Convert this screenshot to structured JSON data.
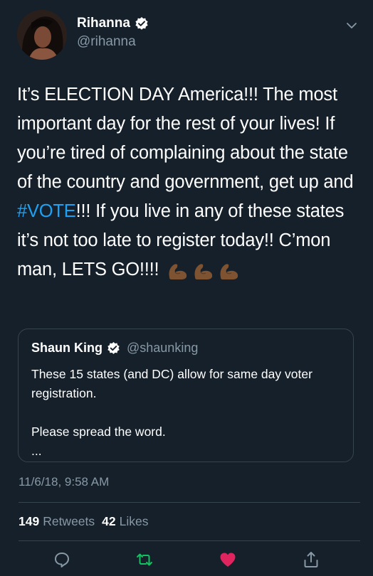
{
  "author": {
    "name": "Rihanna",
    "handle": "@rihanna"
  },
  "tweet": {
    "text_before": "It’s ELECTION DAY America!!! The most important day for the rest of your lives! If you’re tired of complaining about the state of the country and government, get up and ",
    "hashtag": "#VOTE",
    "text_after": "!!! If you live in any of these states it’s not too late to register today!! C’mon man, LETS GO!!!! ",
    "emojis": [
      "flexed-biceps-icon",
      "flexed-biceps-icon",
      "flexed-biceps-icon"
    ]
  },
  "quote": {
    "name": "Shaun King",
    "handle": "@shaunking",
    "line1": "These 15 states (and DC) allow for same day voter registration.",
    "line2": "Please spread the word.",
    "ellipsis": "..."
  },
  "timestamp": "11/6/18, 9:58 AM",
  "stats": {
    "retweets_count": "149",
    "retweets_label": "Retweets",
    "likes_count": "42",
    "likes_label": "Likes"
  },
  "colors": {
    "background": "#15202b",
    "link": "#1da1f2",
    "muted": "#8899a6",
    "retweet_active": "#17bf63",
    "like_active": "#e0245e"
  }
}
